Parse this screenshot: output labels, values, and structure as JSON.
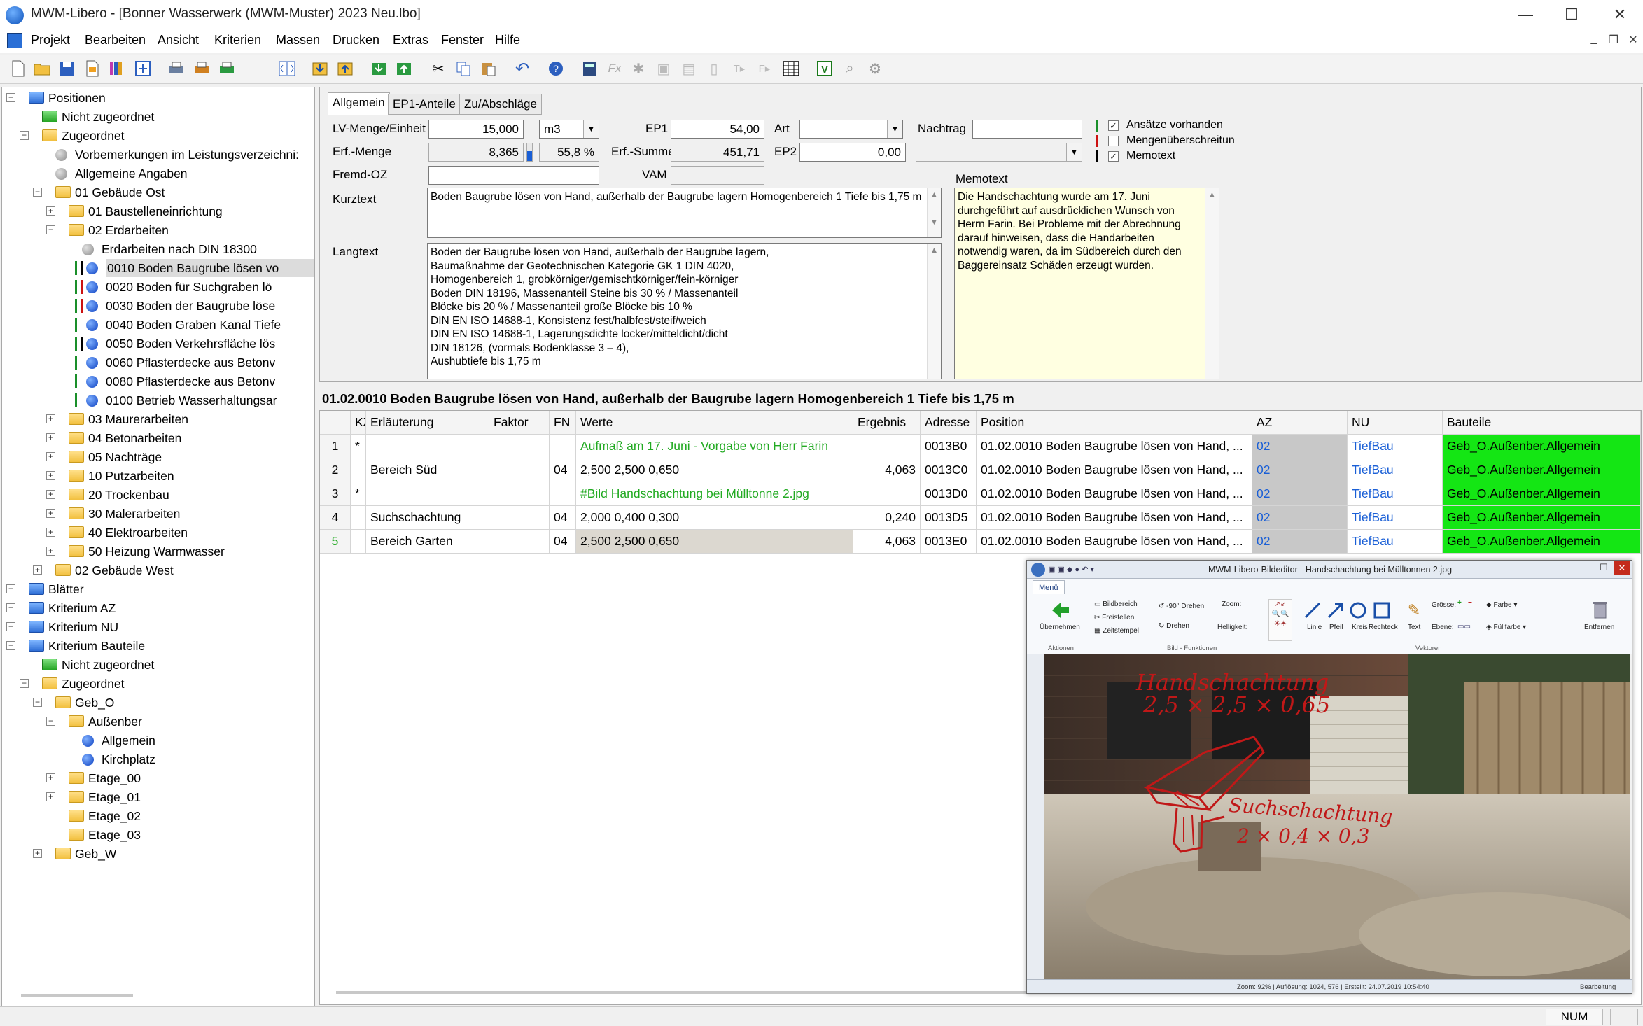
{
  "window": {
    "title": "MWM-Libero - [Bonner Wasserwerk (MWM-Muster) 2023 Neu.lbo]",
    "minimize": "—",
    "maximize": "☐",
    "close": "✕"
  },
  "menu": [
    "Projekt",
    "Bearbeiten",
    "Ansicht",
    "Kriterien",
    "Massen",
    "Drucken",
    "Extras",
    "Fenster",
    "Hilfe"
  ],
  "mdi": {
    "minimize": "_",
    "restore": "❐",
    "close": "✕"
  },
  "tree": {
    "nodes": [
      {
        "text": "Positionen",
        "kind": "fold-b",
        "exp": "−"
      },
      {
        "text": "Nicht zugeordnet",
        "kind": "fold-g"
      },
      {
        "text": "Zugeordnet",
        "kind": "fold-y",
        "exp": "−"
      },
      {
        "text": "Vorbemerkungen im Leistungsverzeichni:",
        "kind": "dot-g"
      },
      {
        "text": "Allgemeine Angaben",
        "kind": "dot-g"
      },
      {
        "text": "01 Gebäude Ost",
        "kind": "fold-y",
        "exp": "−"
      },
      {
        "text": "01 Baustelleneinrichtung",
        "kind": "fold-y",
        "exp": "+"
      },
      {
        "text": "02 Erdarbeiten",
        "kind": "fold-y",
        "exp": "−"
      },
      {
        "text": "Erdarbeiten nach DIN 18300",
        "kind": "dot-g"
      },
      {
        "text": "0010  Boden Baugrube lösen vo",
        "kind": "dot-b",
        "bars": [
          "#1a8f2a",
          "#000000"
        ],
        "selected": true
      },
      {
        "text": "0020  Boden für Suchgraben lö",
        "kind": "dot-b",
        "bars": [
          "#1a8f2a",
          "#cc1111"
        ]
      },
      {
        "text": "0030  Boden der Baugrube löse",
        "kind": "dot-b",
        "bars": [
          "#1a8f2a",
          "#cc1111"
        ]
      },
      {
        "text": "0040  Boden Graben Kanal Tiefe",
        "kind": "dot-b",
        "bars": [
          "#1a8f2a"
        ]
      },
      {
        "text": "0050  Boden Verkehrsfläche lös",
        "kind": "dot-b",
        "bars": [
          "#1a8f2a",
          "#000000"
        ]
      },
      {
        "text": "0060  Pflasterdecke aus Betonv",
        "kind": "dot-b",
        "bars": [
          "#1a8f2a"
        ]
      },
      {
        "text": "0080  Pflasterdecke aus Betonv",
        "kind": "dot-b",
        "bars": [
          "#1a8f2a"
        ]
      },
      {
        "text": "0100  Betrieb Wasserhaltungsar",
        "kind": "dot-b",
        "bars": [
          "#1a8f2a"
        ]
      },
      {
        "text": "03 Maurerarbeiten",
        "kind": "fold-y",
        "exp": "+"
      },
      {
        "text": "04 Betonarbeiten",
        "kind": "fold-y",
        "exp": "+"
      },
      {
        "text": "05 Nachträge",
        "kind": "fold-y",
        "exp": "+"
      },
      {
        "text": "10 Putzarbeiten",
        "kind": "fold-y",
        "exp": "+"
      },
      {
        "text": "20 Trockenbau",
        "kind": "fold-y",
        "exp": "+"
      },
      {
        "text": "30 Malerarbeiten",
        "kind": "fold-y",
        "exp": "+"
      },
      {
        "text": "40 Elektroarbeiten",
        "kind": "fold-y",
        "exp": "+"
      },
      {
        "text": "50 Heizung Warmwasser",
        "kind": "fold-y",
        "exp": "+"
      },
      {
        "text": "02 Gebäude West",
        "kind": "fold-y",
        "exp": "+"
      },
      {
        "text": "Blätter",
        "kind": "fold-b",
        "exp": "+"
      },
      {
        "text": "Kriterium AZ",
        "kind": "fold-b",
        "exp": "+"
      },
      {
        "text": "Kriterium NU",
        "kind": "fold-b",
        "exp": "+"
      },
      {
        "text": "Kriterium Bauteile",
        "kind": "fold-b",
        "exp": "−"
      },
      {
        "text": "Nicht zugeordnet",
        "kind": "fold-g"
      },
      {
        "text": "Zugeordnet",
        "kind": "fold-y",
        "exp": "−"
      },
      {
        "text": "Geb_O",
        "kind": "fold-y",
        "exp": "−"
      },
      {
        "text": "Außenber",
        "kind": "fold-y",
        "exp": "−"
      },
      {
        "text": "Allgemein",
        "kind": "dot-b"
      },
      {
        "text": "Kirchplatz",
        "kind": "dot-b"
      },
      {
        "text": "Etage_00",
        "kind": "fold-y",
        "exp": "+"
      },
      {
        "text": "Etage_01",
        "kind": "fold-y",
        "exp": "+"
      },
      {
        "text": "Etage_02",
        "kind": "fold-y"
      },
      {
        "text": "Etage_03",
        "kind": "fold-y"
      },
      {
        "text": "Geb_W",
        "kind": "fold-y",
        "exp": "+"
      }
    ]
  },
  "tabs": [
    "Allgemein",
    "EP1-Anteile",
    "Zu/Abschläge"
  ],
  "form": {
    "lv_label": "LV-Menge/Einheit",
    "lv_menge": "15,000",
    "einheit": "m3",
    "erf_label": "Erf.-Menge",
    "erf_menge": "8,365",
    "erf_prozent": "55,8 %",
    "fremd_label": "Fremd-OZ",
    "fremd_oz": "",
    "ep1_label": "EP1",
    "ep1": "54,00",
    "erfsumme_label": "Erf.-Summe",
    "erf_summe": "451,71",
    "vam_label": "VAM",
    "vam": "",
    "art_label": "Art",
    "art": "",
    "ep2_label": "EP2",
    "ep2": "0,00",
    "nachtrag_label": "Nachtrag",
    "nachtrag": "",
    "check_ansaetze": "Ansätze vorhanden",
    "check_mengen": "Mengenüberschreitun",
    "check_memo": "Memotext",
    "kurztext_label": "Kurztext",
    "kurztext": "Boden Baugrube lösen von Hand, außerhalb der Baugrube lagern Homogenbereich 1 Tiefe bis 1,75 m",
    "langtext_label": "Langtext",
    "langtext": [
      "Boden der Baugrube lösen von Hand, außerhalb der Baugrube lagern,",
      "Baumaßnahme der Geotechnischen Kategorie GK 1 DIN 4020,",
      "Homogenbereich 1, grobkörniger/gemischtkörniger/fein-körniger",
      "Boden DIN 18196, Massenanteil Steine bis 30 % / Massenanteil",
      "Blöcke bis 20 % / Massenanteil große Blöcke bis 10 %",
      "DIN EN ISO 14688-1, Konsistenz fest/halbfest/steif/weich",
      "DIN EN ISO 14688-1, Lagerungsdichte locker/mitteldicht/dicht",
      "DIN 18126, (vormals Bodenklasse 3 – 4),",
      "Aushubtiefe bis 1,75 m"
    ],
    "memo_label": "Memotext",
    "memotext": "Die Handschachtung wurde am 17. Juni durchgeführt auf ausdrücklichen Wunsch von Herrn Farin. Bei Probleme mit der Abrechnung darauf hinweisen, dass die Handarbeiten notwendig waren, da im Südbereich durch den Baggereinsatz Schäden erzeugt wurden."
  },
  "position_header": "01.02.0010  Boden Baugrube lösen von Hand, außerhalb der Baugrube lagern Homogenbereich 1 Tiefe bis 1,75 m",
  "grid": {
    "headers": {
      "nr": "",
      "kz": "KZ",
      "erl": "Erläuterung",
      "faktor": "Faktor",
      "fn": "FN",
      "werte": "Werte",
      "ergebnis": "Ergebnis",
      "adresse": "Adresse",
      "position": "Position",
      "az": "AZ",
      "nu": "NU",
      "bauteile": "Bauteile"
    },
    "rows": [
      {
        "nr": "1",
        "kz": "*",
        "erl": "",
        "faktor": "",
        "fn": "",
        "werte": "Aufmaß am 17. Juni - Vorgabe von Herr Farin",
        "werte_green": true,
        "ergebnis": "",
        "adresse": "0013B0",
        "position": "01.02.0010   Boden Baugrube lösen von Hand, ...",
        "az": "02",
        "nu": "TiefBau",
        "bauteile": "Geb_O.Außenber.Allgemein"
      },
      {
        "nr": "2",
        "kz": "",
        "erl": "Bereich Süd",
        "faktor": "",
        "fn": "04",
        "werte": "2,500 2,500 0,650",
        "ergebnis": "4,063",
        "adresse": "0013C0",
        "position": "01.02.0010   Boden Baugrube lösen von Hand, ...",
        "az": "02",
        "nu": "TiefBau",
        "bauteile": "Geb_O.Außenber.Allgemein"
      },
      {
        "nr": "3",
        "kz": "*",
        "erl": "",
        "faktor": "",
        "fn": "",
        "werte": "#Bild Handschachtung bei Mülltonne 2.jpg",
        "werte_green": true,
        "ergebnis": "",
        "adresse": "0013D0",
        "position": "01.02.0010   Boden Baugrube lösen von Hand, ...",
        "az": "02",
        "nu": "TiefBau",
        "bauteile": "Geb_O.Außenber.Allgemein"
      },
      {
        "nr": "4",
        "kz": "",
        "erl": "Suchschachtung",
        "faktor": "",
        "fn": "04",
        "werte": "2,000 0,400 0,300",
        "ergebnis": "0,240",
        "adresse": "0013D5",
        "position": "01.02.0010   Boden Baugrube lösen von Hand, ...",
        "az": "02",
        "nu": "TiefBau",
        "bauteile": "Geb_O.Außenber.Allgemein"
      },
      {
        "nr": "5",
        "kz": "",
        "erl": "Bereich Garten",
        "faktor": "",
        "fn": "04",
        "werte": "2,500 2,500 0,650",
        "ergebnis": "4,063",
        "adresse": "0013E0",
        "position": "01.02.0010   Boden Baugrube lösen von Hand, ...",
        "az": "02",
        "nu": "TiefBau",
        "bauteile": "Geb_O.Außenber.Allgemein",
        "current": true
      }
    ]
  },
  "editor": {
    "title": "MWM-Libero-Bildeditor - Handschachtung bei Mülltonnen 2.jpg",
    "tab": "Menü",
    "items": {
      "uebernehmen": "Übernehmen",
      "bildbereich": "Bildbereich",
      "freistellen": "Freistellen",
      "zeitstempel": "Zeitstempel",
      "drehen90": "-90° Drehen",
      "drehen": "Drehen",
      "zoom": "Zoom:",
      "helligkeit": "Helligkeit:",
      "linie": "Linie",
      "pfeil": "Pfeil",
      "kreis": "Kreis",
      "rechteck": "Rechteck",
      "text": "Text",
      "groesse": "Grösse:",
      "ebene": "Ebene:",
      "farbe": "Farbe",
      "fuellfarbe": "Füllfarbe",
      "entfernen": "Entfernen"
    },
    "groups": {
      "aktionen": "Aktionen",
      "bildfunktionen": "Bild - Funktionen",
      "vektoren": "Vektoren"
    },
    "annotation1_line1": "Handschachtung",
    "annotation1_line2": "2,5 × 2,5 × 0,65",
    "annotation2_line1": "Suchschachtung",
    "annotation2_line2": "2 × 0,4 × 0,3",
    "status": "Zoom: 92%  |  Auflösung: 1024, 576  |  Erstellt: 24.07.2019 10:54:40",
    "status_right": "Bearbeitung"
  },
  "status": {
    "num": "NUM"
  }
}
